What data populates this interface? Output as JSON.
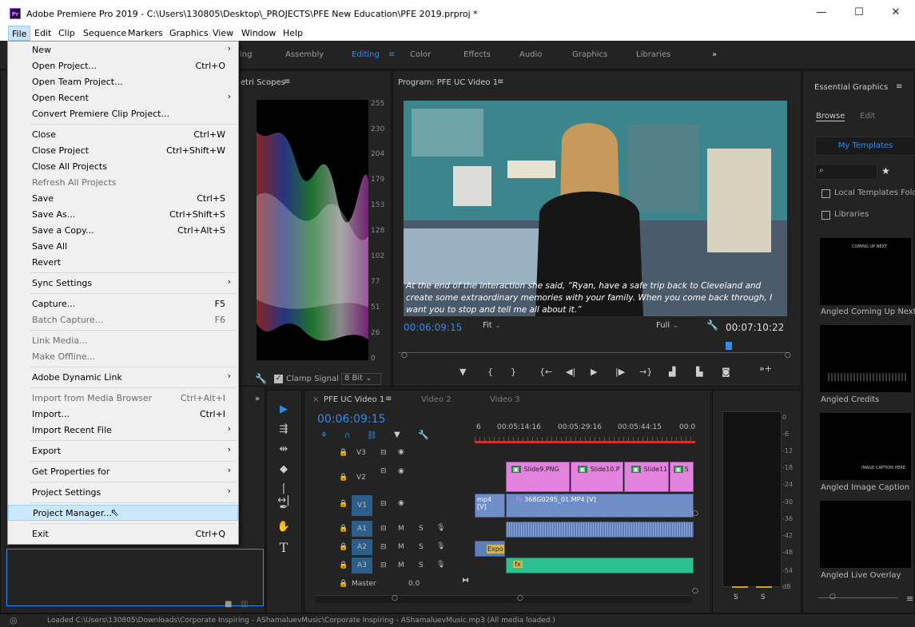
{
  "window": {
    "app_icon": "Pr",
    "title": "Adobe Premiere Pro 2019 - C:\\Users\\130805\\Desktop\\_PROJECTS\\PFE New Education\\PFE 2019.prproj *",
    "minimize": "—",
    "maximize": "☐",
    "close": "✕"
  },
  "menubar": [
    "File",
    "Edit",
    "Clip",
    "Sequence",
    "Markers",
    "Graphics",
    "View",
    "Window",
    "Help"
  ],
  "workspaces": {
    "items": [
      "ing",
      "Assembly",
      "Editing",
      "Color",
      "Effects",
      "Audio",
      "Graphics",
      "Libraries"
    ],
    "active": "Editing",
    "more": "»"
  },
  "file_menu": [
    {
      "label": "New",
      "shortcut": "",
      "submenu": true,
      "disabled": false
    },
    {
      "label": "Open Project...",
      "shortcut": "Ctrl+O",
      "submenu": false,
      "disabled": false
    },
    {
      "label": "Open Team Project...",
      "shortcut": "",
      "submenu": false,
      "disabled": false
    },
    {
      "label": "Open Recent",
      "shortcut": "",
      "submenu": true,
      "disabled": false
    },
    {
      "label": "Convert Premiere Clip Project...",
      "shortcut": "",
      "submenu": false,
      "disabled": false
    },
    {
      "label": "Close",
      "shortcut": "Ctrl+W",
      "submenu": false,
      "disabled": false
    },
    {
      "label": "Close Project",
      "shortcut": "Ctrl+Shift+W",
      "submenu": false,
      "disabled": false
    },
    {
      "label": "Close All Projects",
      "shortcut": "",
      "submenu": false,
      "disabled": false
    },
    {
      "label": "Refresh All Projects",
      "shortcut": "",
      "submenu": false,
      "disabled": true
    },
    {
      "label": "Save",
      "shortcut": "Ctrl+S",
      "submenu": false,
      "disabled": false
    },
    {
      "label": "Save As...",
      "shortcut": "Ctrl+Shift+S",
      "submenu": false,
      "disabled": false
    },
    {
      "label": "Save a Copy...",
      "shortcut": "Ctrl+Alt+S",
      "submenu": false,
      "disabled": false
    },
    {
      "label": "Save All",
      "shortcut": "",
      "submenu": false,
      "disabled": false
    },
    {
      "label": "Revert",
      "shortcut": "",
      "submenu": false,
      "disabled": false
    },
    {
      "label": "Sync Settings",
      "shortcut": "",
      "submenu": true,
      "disabled": false
    },
    {
      "label": "Capture...",
      "shortcut": "F5",
      "submenu": false,
      "disabled": false
    },
    {
      "label": "Batch Capture...",
      "shortcut": "F6",
      "submenu": false,
      "disabled": true
    },
    {
      "label": "Link Media...",
      "shortcut": "",
      "submenu": false,
      "disabled": true
    },
    {
      "label": "Make Offline...",
      "shortcut": "",
      "submenu": false,
      "disabled": true
    },
    {
      "label": "Adobe Dynamic Link",
      "shortcut": "",
      "submenu": true,
      "disabled": false
    },
    {
      "label": "Import from Media Browser",
      "shortcut": "Ctrl+Alt+I",
      "submenu": false,
      "disabled": true
    },
    {
      "label": "Import...",
      "shortcut": "Ctrl+I",
      "submenu": false,
      "disabled": false
    },
    {
      "label": "Import Recent File",
      "shortcut": "",
      "submenu": true,
      "disabled": false
    },
    {
      "label": "Export",
      "shortcut": "",
      "submenu": true,
      "disabled": false
    },
    {
      "label": "Get Properties for",
      "shortcut": "",
      "submenu": true,
      "disabled": false
    },
    {
      "label": "Project Settings",
      "shortcut": "",
      "submenu": true,
      "disabled": false
    },
    {
      "label": "Project Manager...",
      "shortcut": "",
      "submenu": false,
      "disabled": false,
      "highlighted": true
    },
    {
      "label": "Exit",
      "shortcut": "Ctrl+Q",
      "submenu": false,
      "disabled": false
    }
  ],
  "scopes": {
    "title": "etri Scopes",
    "levels": [
      "255",
      "230",
      "204",
      "179",
      "153",
      "128",
      "102",
      "77",
      "51",
      "26",
      "0"
    ],
    "clamp_signal": "Clamp Signal",
    "bit_depth": "8 Bit"
  },
  "program": {
    "title": "Program: PFE UC Video 1",
    "caption": "At the end of the interaction she said, “Ryan, have a safe trip back to Cleveland and create some extraordinary memories with your family. When you come back through, I want you to stop and tell me all about it.”",
    "current_time": "00:06:09:15",
    "fit": "Fit",
    "quality": "Full",
    "duration": "00:07:10:22"
  },
  "timeline": {
    "tabs": [
      "PFE UC Video 1",
      "Video 2",
      "Video 3"
    ],
    "timecode": "00:06:09:15",
    "ruler": [
      "6",
      "00:05:14:16",
      "00:05:29:16",
      "00:05:44:15",
      "00:0"
    ],
    "tracks": [
      "V3",
      "V2",
      "V1",
      "A1",
      "A2",
      "A3"
    ],
    "master": "Master",
    "master_value": "0.0",
    "clips_v2": [
      "Slide9.PNG",
      "Slide10.P",
      "Slide11",
      "S"
    ],
    "clip_v1_left": "mp4 [V]",
    "clip_v1": "368G0295_01.MP4 [V]",
    "clip_a2": "Expo"
  },
  "meter": {
    "levels": [
      "0",
      "-6",
      "-12",
      "-18",
      "-24",
      "-30",
      "-36",
      "-42",
      "-48",
      "-54",
      "dB"
    ],
    "solo": [
      "S",
      "S"
    ]
  },
  "essential_graphics": {
    "title": "Essential Graphics",
    "tabs": [
      "Browse",
      "Edit"
    ],
    "dropdown": "My Templates",
    "local_templates": "Local Templates Folde",
    "libraries": "Libraries",
    "templates": [
      "Angled Coming Up Next",
      "Angled Credits",
      "Angled Image Caption",
      "Angled Live Overlay"
    ],
    "thumb_texts": [
      "COMING UP NEXT",
      "IMAGE CAPTION HERE"
    ]
  },
  "status": "Loaded C:\\Users\\130805\\Downloads\\Corporate Inspiring - AShamaluevMusic\\Corporate Inspiring - AShamaluevMusic.mp3 (All media loaded.)",
  "colors": {
    "accent": "#2d8ceb",
    "clip_pink": "#e283e0",
    "clip_blue": "#6f8ec8",
    "clip_teal": "#2fbf90"
  }
}
